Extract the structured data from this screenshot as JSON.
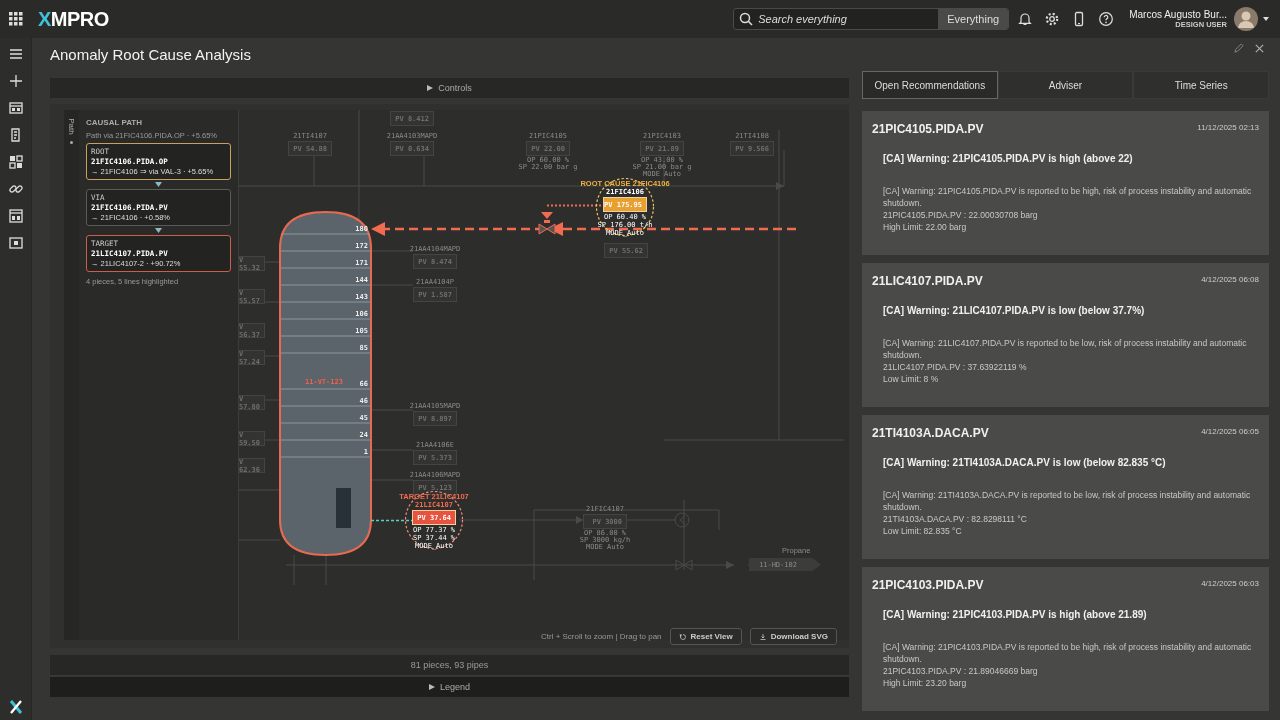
{
  "topbar": {
    "logo": "XMPRO",
    "search": {
      "placeholder": "Search everything"
    },
    "scope_button": "Everything",
    "user": {
      "name": "Marcos Augusto Bur...",
      "role": "DESIGN USER"
    }
  },
  "page": {
    "title": "Anomaly Root Cause Analysis"
  },
  "analysis": {
    "controls_label": "Controls",
    "path_tab": "Path",
    "causal_path": {
      "title": "CAUSAL PATH",
      "subtitle": "Path via 21FIC4106.PIDA.OP · +5.65%",
      "steps": [
        {
          "kind": "root",
          "label": "ROOT",
          "tag": "21FIC4106.PIDA.OP",
          "detail": "→ 21FIC4106 ⇒ via VAL-3 · +5.65%"
        },
        {
          "kind": "via",
          "label": "VIA",
          "tag": "21FIC4106.PIDA.PV",
          "detail": "→ 21FIC4106 · +0.58%"
        },
        {
          "kind": "target",
          "label": "TARGET",
          "tag": "21LIC4107.PIDA.PV",
          "detail": "→ 21LIC4107-2 · +90.72%"
        }
      ],
      "summary": "4 pieces, 5 lines highlighted"
    },
    "diagram": {
      "vessel": {
        "label": "11-VT-123",
        "trays": [
          "180",
          "172",
          "171",
          "144",
          "143",
          "106",
          "105",
          "85",
          "66",
          "46",
          "45",
          "24",
          "1"
        ]
      },
      "highlights": [
        {
          "kind": "root",
          "title": "ROOT CAUSE 21FIC4106",
          "tag": "21FIC4106",
          "pv": "PV 175.95",
          "readouts": [
            "OP 60.40 %",
            "SP 176.00 t/h",
            "MODE_Auto"
          ]
        },
        {
          "kind": "target",
          "title": "TARGET 21LIC4107",
          "tag": "21LIC4107",
          "pv": "PV 37.64",
          "readouts": [
            "OP 77.37 %",
            "SP 37.44 %",
            "MODE_Auto"
          ]
        }
      ],
      "instruments": [
        {
          "pv": "PV 8.412"
        },
        {
          "tag": "21TI4107",
          "pv": "PV 54.88"
        },
        {
          "tag": "21AA4103MAPD",
          "pv": "PV 0.634"
        },
        {
          "tag": "21PIC4105",
          "pv": "PV 22.00",
          "readouts": [
            "OP 60.00 %",
            "SP 22.00 bar g"
          ]
        },
        {
          "tag": "21PIC4103",
          "pv": "PV 21.89",
          "readouts": [
            "OP 43.00 %",
            "SP 21.00 bar g",
            "MODE Auto"
          ]
        },
        {
          "tag": "21TI4108",
          "pv": "PV 9.566"
        },
        {
          "pv": "PV 55.62"
        },
        {
          "tag": "21AA4104MAPD",
          "pv": "PV 8.474"
        },
        {
          "tag": "21AA4104P",
          "pv": "PV 1.587"
        },
        {
          "tag": "21AA4105MAPD",
          "pv": "PV 8.897"
        },
        {
          "tag": "21AA4106E",
          "pv": "PV 5.373"
        },
        {
          "tag": "21AA4106MAPD",
          "pv": "PV 5.123"
        },
        {
          "tag": "21FIC4107",
          "pv": "PV 3000",
          "readouts": [
            "OP 86.00 %",
            "SP 3000 kg/h",
            "MODE Auto"
          ]
        }
      ],
      "partial_readings": [
        "V 55.32",
        "V 55.57",
        "V 56.37",
        "V 57.24",
        "V 57.80",
        "V 59.50",
        "V 62.36"
      ],
      "product": {
        "label": "Propane",
        "tag": "11-HD-102"
      }
    },
    "hint": "Ctrl + Scroll to zoom | Drag to pan",
    "buttons": [
      "Reset View",
      "Download SVG"
    ],
    "stats": "81 pieces, 93 pipes",
    "legend_label": "Legend"
  },
  "recommendations": {
    "tabs": [
      {
        "label": "Open Recommendations",
        "selected": true
      },
      {
        "label": "Adviser",
        "selected": false
      },
      {
        "label": "Time Series",
        "selected": false
      }
    ],
    "cards": [
      {
        "tag": "21PIC4105.PIDA.PV",
        "time": "11/12/2025 02:13",
        "warning": "[CA] Warning: 21PIC4105.PIDA.PV is high (above 22)",
        "description": "[CA] Warning: 21PIC4105.PIDA.PV is reported to be high, risk of process instability and automatic shutdown.",
        "lines": [
          "21PIC4105.PIDA.PV : 22.00030708 barg",
          "High Limit: 22.00 barg"
        ]
      },
      {
        "tag": "21LIC4107.PIDA.PV",
        "time": "4/12/2025 06:08",
        "warning": "[CA] Warning: 21LIC4107.PIDA.PV is low (below 37.7%)",
        "description": "[CA] Warning: 21LIC4107.PIDA.PV is reported to be low, risk of process instability and automatic shutdown.",
        "lines": [
          "21LIC4107.PIDA.PV : 37.63922119 %",
          "Low Limit: 8 %"
        ]
      },
      {
        "tag": "21TI4103A.DACA.PV",
        "time": "4/12/2025 06:05",
        "warning": "[CA] Warning: 21TI4103A.DACA.PV is low (below 82.835 °C)",
        "description": "[CA] Warning: 21TI4103A.DACA.PV is reported to be low, risk of process instability and automatic shutdown.",
        "lines": [
          "21TI4103A.DACA.PV : 82.8298111 °C",
          "Low Limit: 82.835 °C"
        ]
      },
      {
        "tag": "21PIC4103.PIDA.PV",
        "time": "4/12/2025 06:03",
        "warning": "[CA] Warning: 21PIC4103.PIDA.PV is high (above 21.89)",
        "description": "[CA] Warning: 21PIC4103.PIDA.PV is reported to be high, risk of process instability and automatic shutdown.",
        "lines": [
          "21PIC4103.PIDA.PV : 21.89046669 barg",
          "High Limit: 23.20 barg"
        ]
      }
    ]
  }
}
